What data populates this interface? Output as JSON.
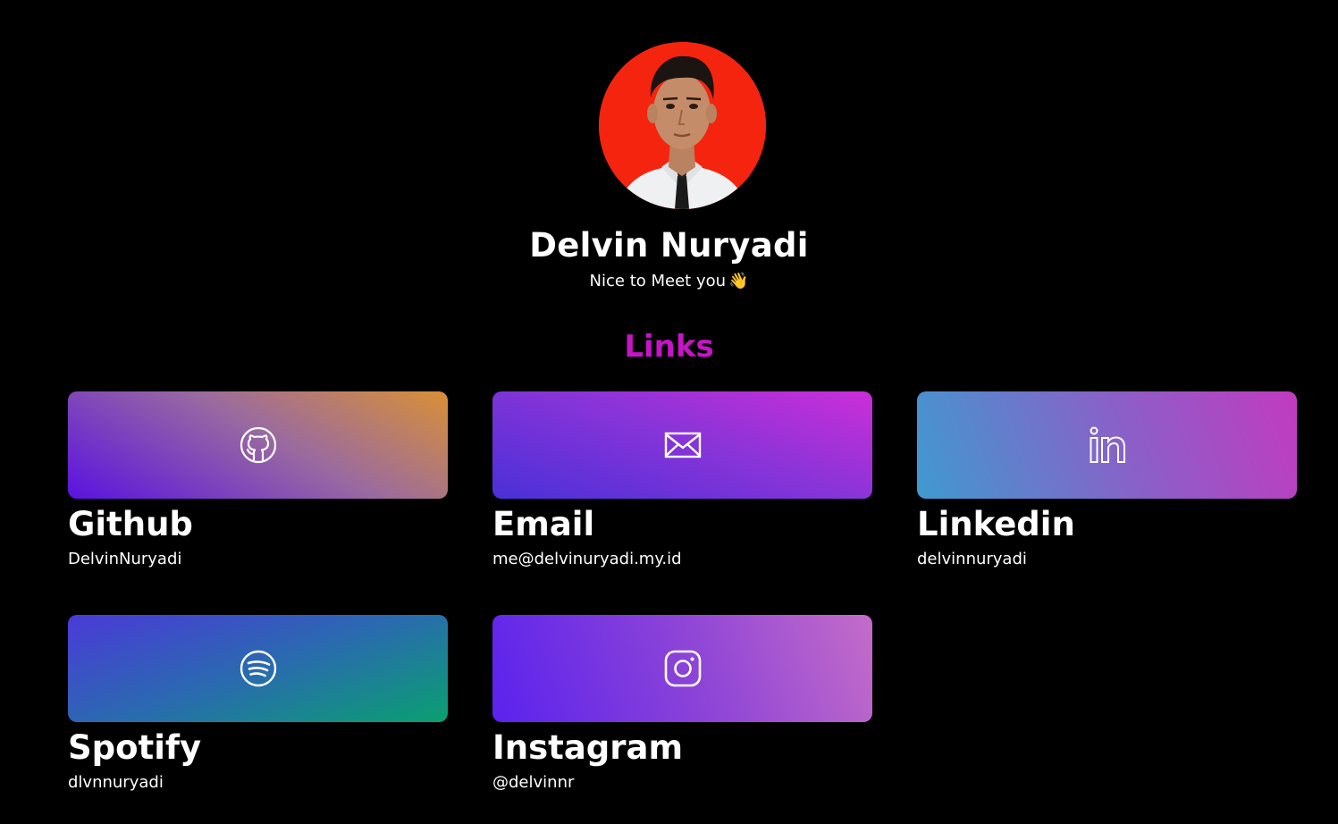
{
  "profile": {
    "name": "Delvin Nuryadi",
    "greeting": "Nice to Meet you",
    "greeting_emoji": "👋",
    "avatar_background": "#f5240f"
  },
  "links_section": {
    "title": "Links",
    "title_color": "#c614c6"
  },
  "links": [
    {
      "title": "Github",
      "handle": "DelvinNuryadi",
      "icon": "github-icon"
    },
    {
      "title": "Email",
      "handle": "me@delvinuryadi.my.id",
      "icon": "mail-icon"
    },
    {
      "title": "Linkedin",
      "handle": "delvinnuryadi",
      "icon": "linkedin-icon"
    },
    {
      "title": "Spotify",
      "handle": "dlvnnuryadi",
      "icon": "spotify-icon"
    },
    {
      "title": "Instagram",
      "handle": "@delvinnr",
      "icon": "instagram-icon"
    }
  ]
}
